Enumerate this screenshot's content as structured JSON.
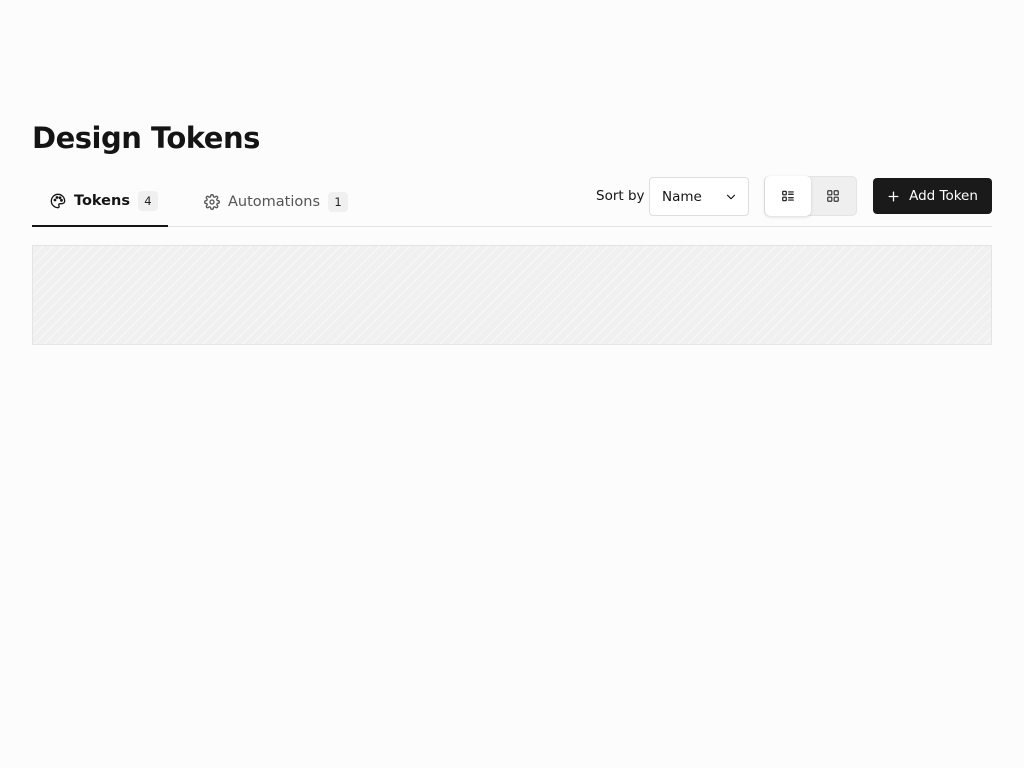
{
  "page": {
    "title": "Design Tokens"
  },
  "tabs": [
    {
      "label": "Tokens",
      "count": "4",
      "icon": "palette-icon",
      "active": true
    },
    {
      "label": "Automations",
      "count": "1",
      "icon": "gear-icon",
      "active": false
    }
  ],
  "toolbar": {
    "sort_label": "Sort by",
    "sort_value": "Name",
    "view_modes": [
      {
        "name": "list",
        "icon": "list-view-icon",
        "active": true
      },
      {
        "name": "grid",
        "icon": "grid-view-icon",
        "active": false
      }
    ],
    "add_label": "Add Token"
  },
  "colors": {
    "primary": "#1a1a1a",
    "background": "#fcfcfc",
    "border": "#e4e4e4",
    "placeholder": "#f0f0f0"
  }
}
